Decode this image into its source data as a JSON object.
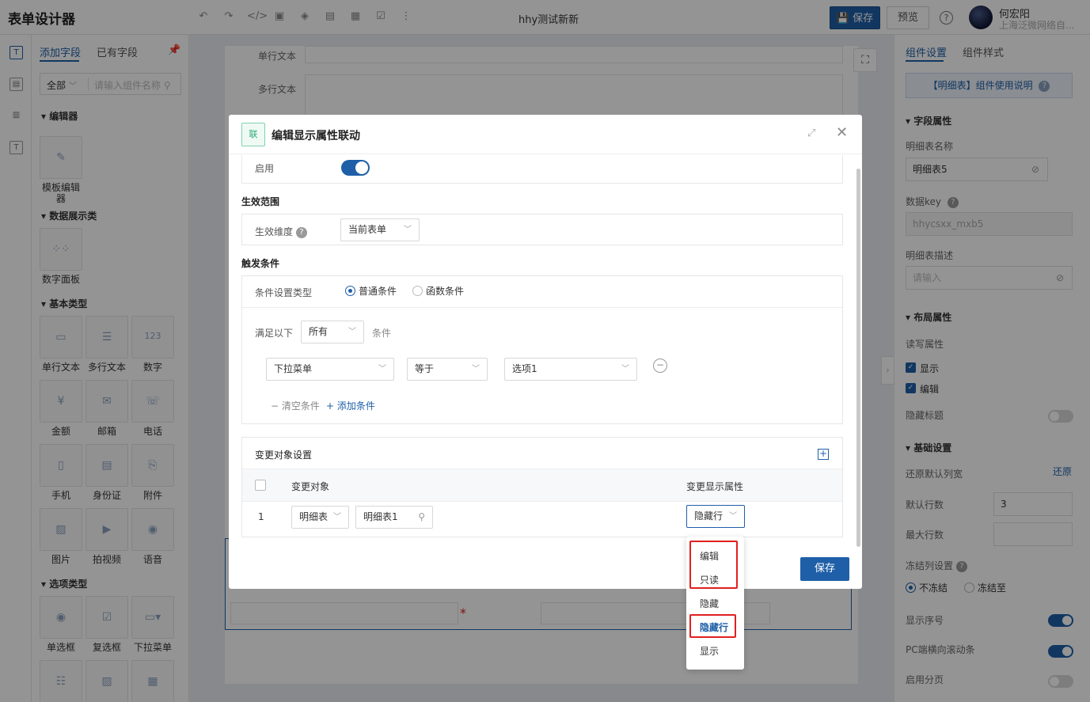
{
  "app": {
    "title": "表单设计器",
    "form_name": "hhy测试新新",
    "save": "保存",
    "preview": "预览",
    "help": "?"
  },
  "user": {
    "name": "何宏阳",
    "org": "上海泛微网络自..."
  },
  "left_panel": {
    "tabs": [
      "添加字段",
      "已有字段"
    ],
    "filter_select": "全部",
    "search_placeholder": "请输入组件名称",
    "sections": {
      "editor": "编辑器",
      "data_display": "数据展示类",
      "basic": "基本类型",
      "options": "选项类型"
    },
    "components": {
      "template_editor": "模板编辑器",
      "digit_panel": "数字面板",
      "single_text": "单行文本",
      "multi_text": "多行文本",
      "number": "数字",
      "amount": "金额",
      "email": "邮箱",
      "phone": "电话",
      "mobile": "手机",
      "id_card": "身份证",
      "attachment": "附件",
      "image": "图片",
      "video": "拍视频",
      "voice": "语音",
      "radio": "单选框",
      "checkbox": "复选框",
      "dropdown": "下拉菜单"
    }
  },
  "canvas": {
    "label_single": "单行文本",
    "label_multi": "多行文本"
  },
  "modal": {
    "title": "编辑显示属性联动",
    "icon_text": "联",
    "enable_label": "启用",
    "scope_section": "生效范围",
    "scope_dim_label": "生效维度",
    "scope_dim_value": "当前表单",
    "trigger_section": "触发条件",
    "cond_type_label": "条件设置类型",
    "cond_type_normal": "普通条件",
    "cond_type_func": "函数条件",
    "satisfy_prefix": "满足以下",
    "satisfy_value": "所有",
    "satisfy_suffix": "条件",
    "cond_field": "下拉菜单",
    "cond_op": "等于",
    "cond_value": "选项1",
    "clear_cond": "清空条件",
    "add_cond": "添加条件",
    "target_section": "变更对象设置",
    "col_target": "变更对象",
    "col_prop": "变更显示属性",
    "row_index": "1",
    "row_type": "明细表",
    "row_target": "明细表1",
    "row_prop": "隐藏行",
    "save": "保存"
  },
  "dropdown_options": [
    "编辑",
    "只读",
    "隐藏",
    "隐藏行",
    "显示"
  ],
  "right_panel": {
    "tabs": [
      "组件设置",
      "组件样式"
    ],
    "help_btn": "【明细表】组件使用说明",
    "field_props": "字段属性",
    "name_label": "明细表名称",
    "name_value": "明细表5",
    "key_label": "数据key",
    "key_value": "hhycsxx_mxb5",
    "desc_label": "明细表描述",
    "desc_placeholder": "请输入",
    "layout_props": "布局属性",
    "rw_label": "读写属性",
    "show": "显示",
    "edit": "编辑",
    "hide_title": "隐藏标题",
    "basic_settings": "基础设置",
    "restore_width": "还原默认列宽",
    "restore": "还原",
    "default_rows": "默认行数",
    "default_rows_value": "3",
    "max_rows": "最大行数",
    "freeze_label": "冻结列设置",
    "no_freeze": "不冻结",
    "freeze_to": "冻结至",
    "show_index": "显示序号",
    "pc_scroll": "PC端横向滚动条",
    "paging": "启用分页"
  }
}
